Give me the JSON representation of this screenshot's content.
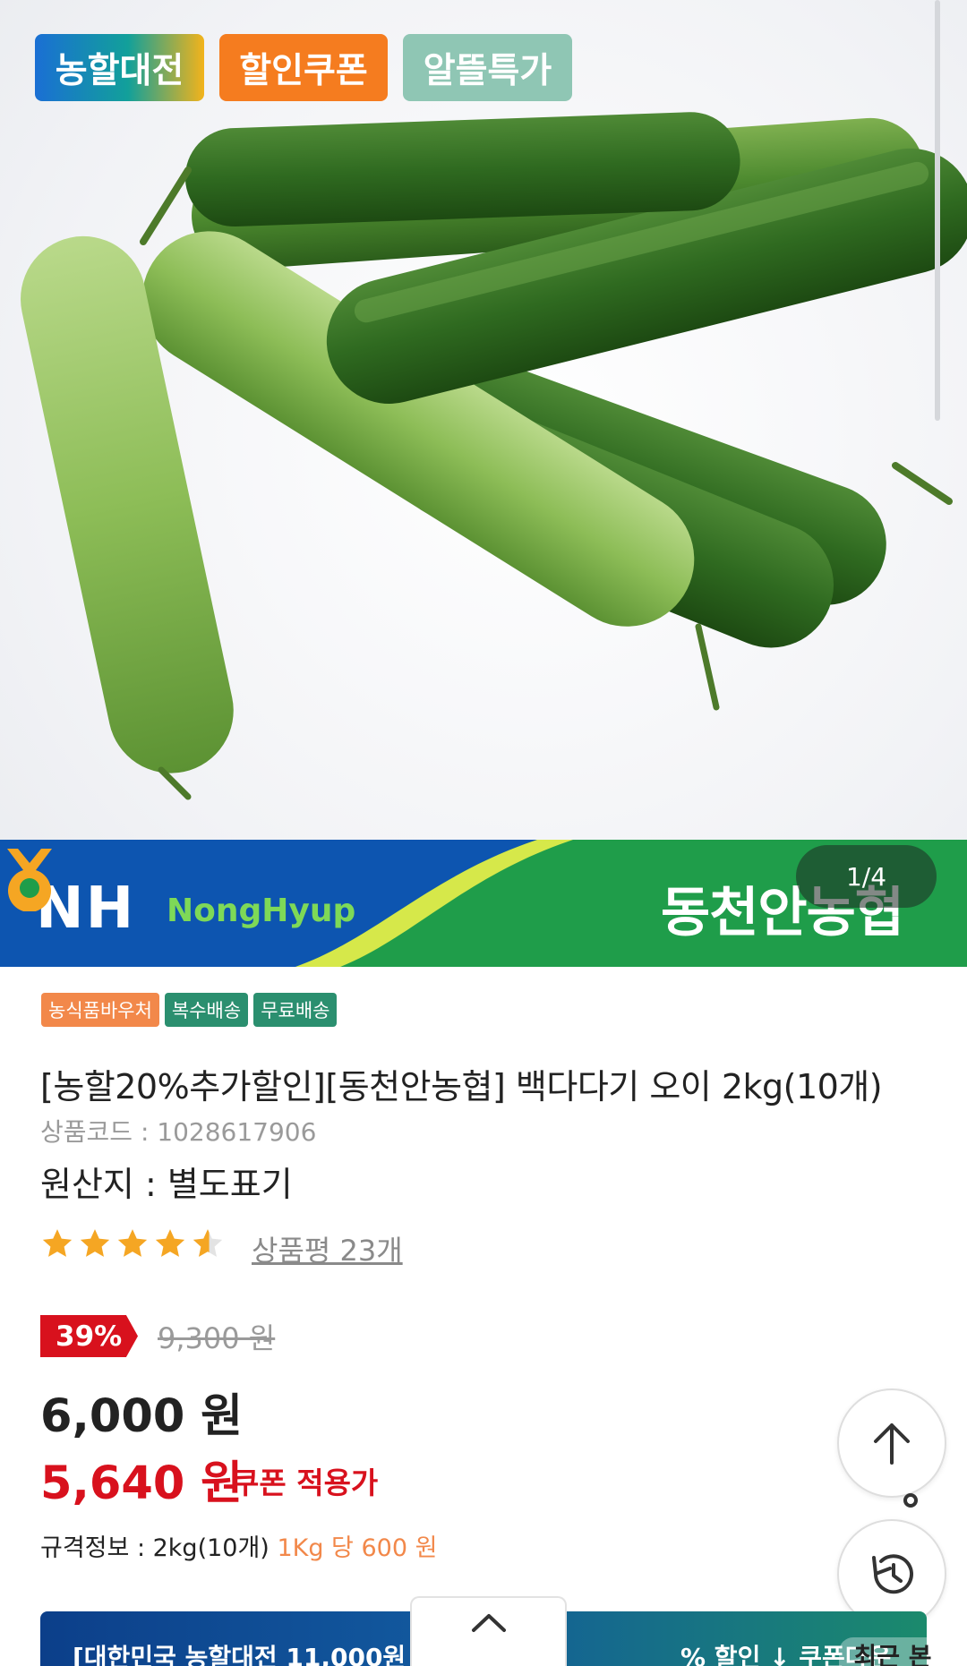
{
  "promo_tags": [
    {
      "label": "농할대전"
    },
    {
      "label": "할인쿠폰"
    },
    {
      "label": "알뜰특가"
    }
  ],
  "banner": {
    "nh_logo": "NH",
    "nh_sub": "NongHyup",
    "coop_name": "동천안농협",
    "page_indicator": "1/4"
  },
  "badges": [
    "농식품바우처",
    "복수배송",
    "무료배송"
  ],
  "product": {
    "title": "[농할20%추가할인][동천안농협] 백다다기 오이 2kg(10개)",
    "code": "상품코드 : 1028617906",
    "origin": "원산지 : 별도표기",
    "rating_stars": 4.5,
    "review_link": "상품평 23개",
    "discount": "39%",
    "original_price": "9,300 원",
    "price": "6,000 원",
    "coupon_price": "5,640 원",
    "coupon_label": "쿠폰 적용가",
    "spec_label": "규격정보 : 2kg(10개)",
    "spec_unit": "1Kg 당  600 원"
  },
  "bottom_bar": {
    "left_text": "[대한민국 농할대전   11,000원",
    "right_text": "% 할인      ↓  쿠폰다운",
    "recent": "최근 본"
  },
  "colors": {
    "accent_red": "#d8111d",
    "accent_orange": "#f57c1f",
    "badge_green": "#2b8f6f",
    "banner_green": "#1f9d4a",
    "banner_blue": "#0d55b0"
  },
  "icons": [
    "arrow-up-icon",
    "history-icon",
    "chevron-up-icon",
    "star-icon",
    "star-half-icon"
  ]
}
